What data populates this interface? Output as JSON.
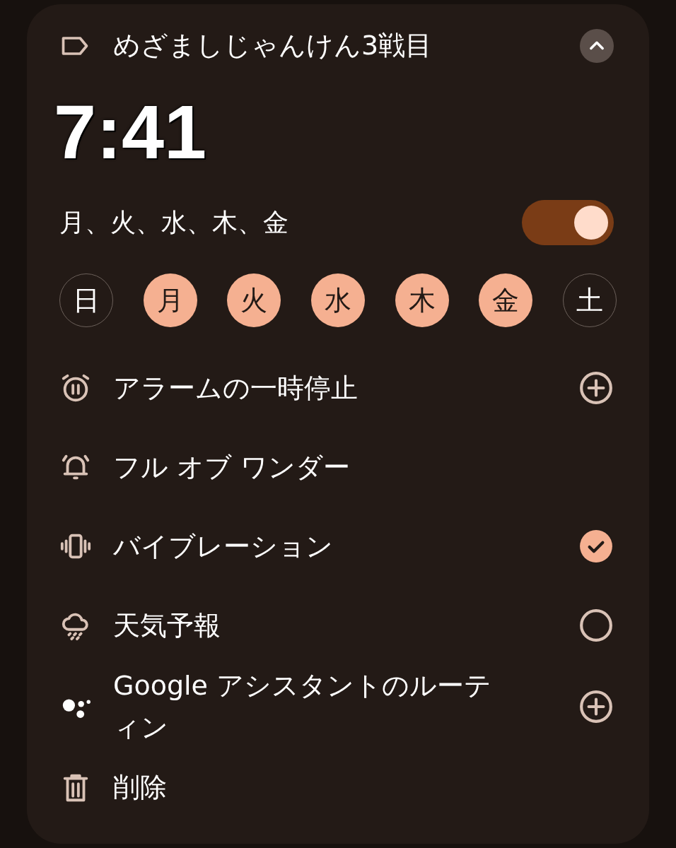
{
  "alarm": {
    "label": "めざましじゃんけん3戦目",
    "expanded": true,
    "time": "7:41",
    "repeat_text": "月、火、水、木、金",
    "on": true
  },
  "days": [
    {
      "label": "日",
      "selected": false
    },
    {
      "label": "月",
      "selected": true
    },
    {
      "label": "火",
      "selected": true
    },
    {
      "label": "水",
      "selected": true
    },
    {
      "label": "木",
      "selected": true
    },
    {
      "label": "金",
      "selected": true
    },
    {
      "label": "土",
      "selected": false
    }
  ],
  "options": [
    {
      "label": "アラームの一時停止",
      "kind": "add"
    },
    {
      "label": "フル オブ ワンダー",
      "kind": "plain"
    },
    {
      "label": "バイブレーション",
      "kind": "check",
      "checked": true
    },
    {
      "label": "天気予報",
      "kind": "check",
      "checked": false
    },
    {
      "label": "Google アシスタントのルーティン",
      "kind": "add"
    },
    {
      "label": "削除",
      "kind": "plain"
    }
  ]
}
